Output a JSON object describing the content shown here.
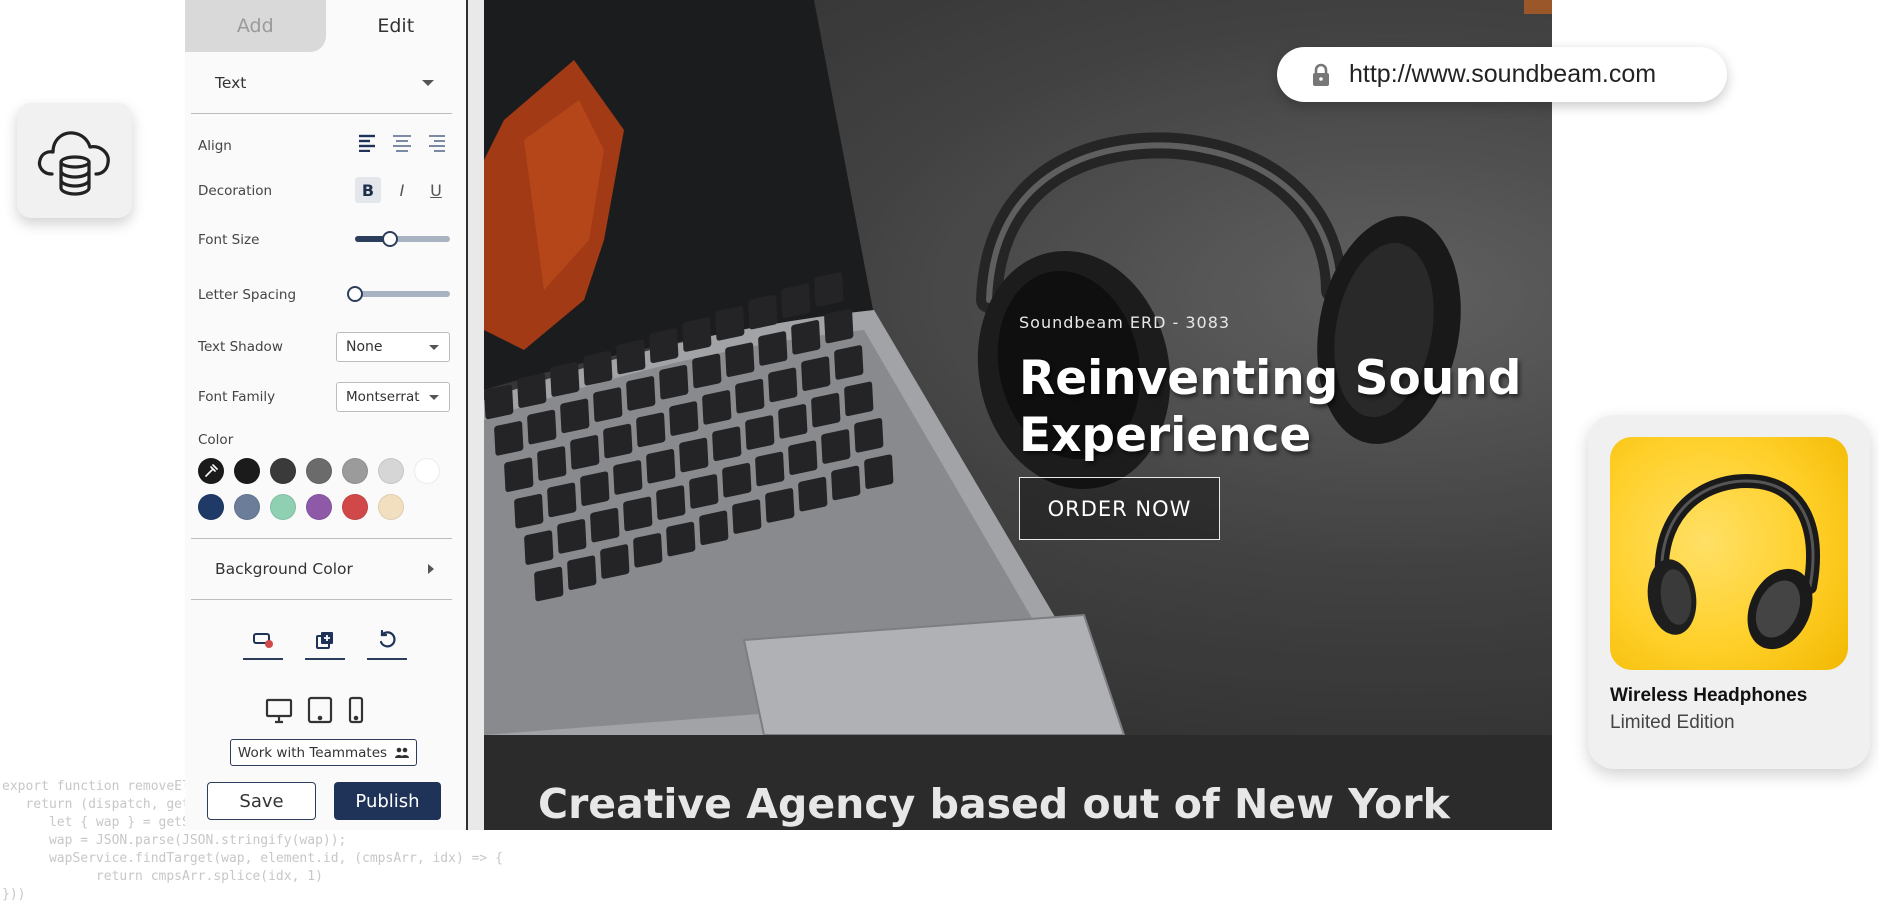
{
  "editor": {
    "tabs": [
      {
        "label": "Add",
        "active": false
      },
      {
        "label": "Edit",
        "active": true
      }
    ],
    "section": "Text",
    "props": {
      "align": "Align",
      "decoration": "Decoration",
      "font_size": "Font Size",
      "letter_spacing": "Letter Spacing",
      "text_shadow": "Text Shadow",
      "font_family": "Font Family",
      "color": "Color"
    },
    "decoration_buttons": {
      "bold": "B",
      "italic": "I",
      "underline": "U"
    },
    "font_size_level": 0.37,
    "letter_spacing_level": 0.0,
    "text_shadow_value": "None",
    "font_family_value": "Montserrat",
    "color_swatches_row1": [
      "#1b1b1b",
      "#1b1b1b",
      "#3a3a3a",
      "#6b6b6b",
      "#9b9b9b",
      "#d6d6d6",
      "#ffffff"
    ],
    "color_swatches_row2": [
      "#1f3a66",
      "#6b7d98",
      "#8fcfb2",
      "#8e5aa8",
      "#d14848",
      "#f2dfc0"
    ],
    "background_color_label": "Background Color",
    "teammates_label": "Work with Teammates",
    "save_label": "Save",
    "publish_label": "Publish"
  },
  "preview": {
    "eyebrow": "Soundbeam ERD - 3083",
    "hero_title": "Reinventing Sound Experience",
    "cta_label": "ORDER NOW",
    "agency_title": "Creative Agency based out of New York"
  },
  "url_bar": {
    "url": "http://www.soundbeam.com"
  },
  "product": {
    "name": "Wireless Headphones",
    "subtitle": "Limited Edition"
  },
  "code_snippet": "export function removeEler\n   return (dispatch, getState\n      let { wap } = getState().\n      wap = JSON.parse(JSON.stringify(wap));\n      wapService.findTarget(wap, element.id, (cmpsArr, idx) => {\n            return cmpsArr.splice(idx, 1)\n}))"
}
